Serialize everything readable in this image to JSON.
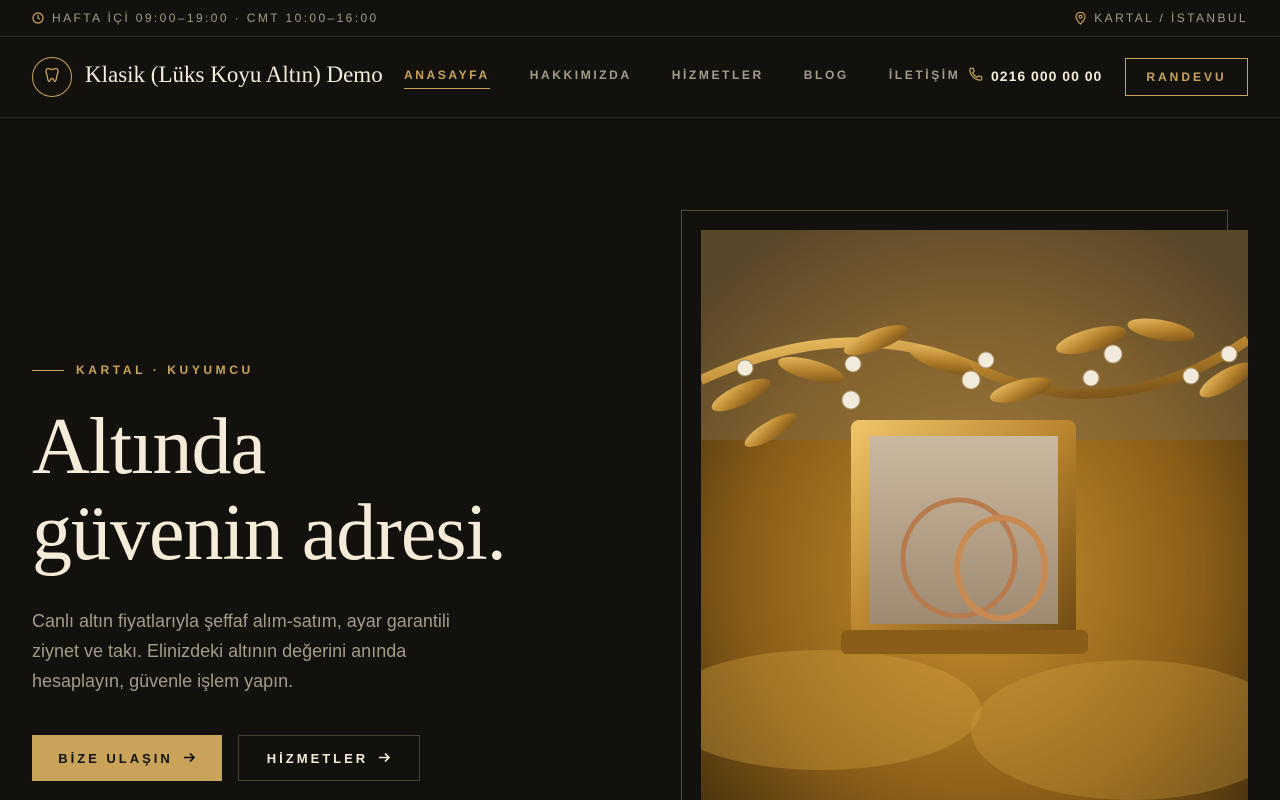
{
  "topbar": {
    "hours": "HAFTA İÇİ 09:00–19:00 · CMT 10:00–16:00",
    "location": "KARTAL / İSTANBUL",
    "hours_icon": "clock-icon",
    "location_icon": "map-pin-icon"
  },
  "header": {
    "brand": "Klasik (Lüks Koyu Altın) Demo",
    "logo_icon": "tooth-icon",
    "nav": [
      {
        "label": "ANASAYFA",
        "active": true
      },
      {
        "label": "HAKKIMIZDA",
        "active": false
      },
      {
        "label": "HİZMETLER",
        "active": false
      },
      {
        "label": "BLOG",
        "active": false
      },
      {
        "label": "İLETİŞİM",
        "active": false
      }
    ],
    "phone": "0216 000 00 00",
    "phone_icon": "phone-icon",
    "cta": "RANDEVU"
  },
  "hero": {
    "eyebrow": "KARTAL · KUYUMCU",
    "headline_line1": "Altında",
    "headline_line2": "güvenin adresi.",
    "lead": "Canlı altın fiyatlarıyla şeffaf alım-satım, ayar garantili ziynet ve takı. Elinizdeki altının değerini anında hesaplayın, güvenle işlem yapın.",
    "primary_button": "BİZE ULAŞIN",
    "secondary_button": "HİZMETLER",
    "arrow_icon": "arrow-right-icon"
  },
  "colors": {
    "background": "#13110e",
    "accent_gold": "#c9a35a",
    "text_light": "#f4ecd8",
    "text_muted": "#a39a88"
  }
}
